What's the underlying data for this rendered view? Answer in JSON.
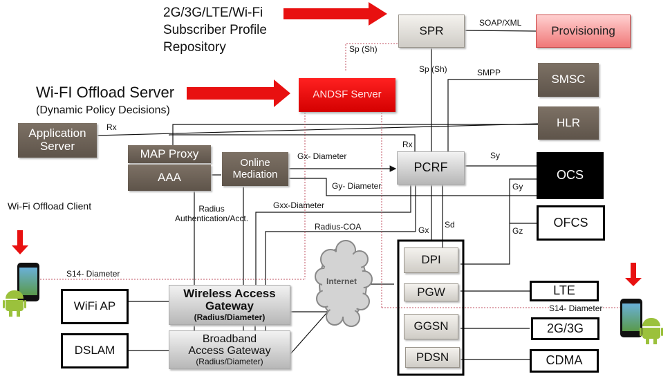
{
  "headings": {
    "spr_desc": [
      "2G/3G/LTE/Wi-Fi",
      "Subscriber Profile",
      "Repository"
    ],
    "offload_server": "Wi-FI Offload Server",
    "offload_server_sub": "(Dynamic Policy Decisions)",
    "offload_client": "Wi-Fi Offload Client"
  },
  "nodes": {
    "spr": "SPR",
    "provisioning": "Provisioning",
    "andsf": "ANDSF Server",
    "smsc": "SMSC",
    "hlr": "HLR",
    "app_server": [
      "Application",
      "Server"
    ],
    "map_proxy": "MAP Proxy",
    "aaa": "AAA",
    "online_mediation": [
      "Online",
      "Mediation"
    ],
    "pcrf": "PCRF",
    "ocs": "OCS",
    "ofcs": "OFCS",
    "dpi": "DPI",
    "pgw": "PGW",
    "ggsn": "GGSN",
    "pdsn": "PDSN",
    "lte": "LTE",
    "g2g3": "2G/3G",
    "cdma": "CDMA",
    "wifi_ap": "WiFi AP",
    "dslam": "DSLAM",
    "internet": "Internet",
    "wag": [
      "Wireless Access",
      "Gateway",
      "(Radius/Diameter)"
    ],
    "bag": [
      "Broadband",
      "Access Gateway",
      "(Radius/Diameter)"
    ]
  },
  "interfaces": {
    "soap_xml": "SOAP/XML",
    "sp_sh_left": "Sp (Sh)",
    "sp_sh_right": "Sp (Sh)",
    "smpp": "SMPP",
    "rx_app": "Rx",
    "rx_pcrf": "Rx",
    "gx_diameter": "Gx- Diameter",
    "gy_diameter": "Gy- Diameter",
    "gxx_diameter": "Gxx-Diameter",
    "radius_auth": [
      "Radius",
      "Authentication/Acct."
    ],
    "radius_coa": "Radius-COA",
    "sy": "Sy",
    "gy": "Gy",
    "gz": "Gz",
    "gx": "Gx",
    "sd": "Sd",
    "s14_left": "S14- Diameter",
    "s14_right": "S14- Diameter"
  },
  "colors": {
    "accent_red": "#e00000",
    "android_green": "#9bc13c"
  }
}
